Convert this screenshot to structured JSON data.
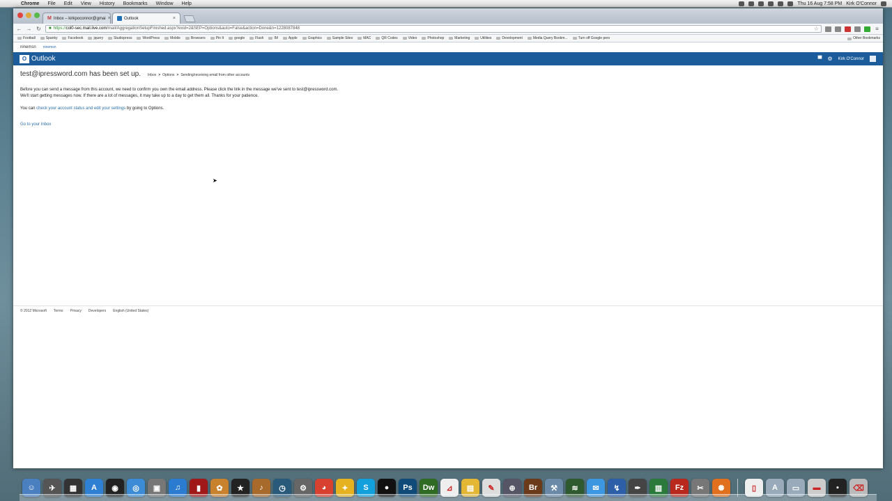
{
  "menubar": {
    "app": "Chrome",
    "items": [
      "File",
      "Edit",
      "View",
      "History",
      "Bookmarks",
      "Window",
      "Help"
    ],
    "clock": "Thu 16 Aug  7:58 PM",
    "user": "Kirk O'Connor"
  },
  "tabs": [
    {
      "title": "Inbox – kirkpoconnor@gmai",
      "favicon": "gmail-icon"
    },
    {
      "title": "Outlook",
      "favicon": "outlook-icon"
    }
  ],
  "address": {
    "proto": "https://",
    "host": "col0-sec.mail.live.com",
    "rest": "/mail/AggregationSetupFinished.aspx?exid=2&SEP=Options&auto=False&action=Done&n=1228087848"
  },
  "bookmarks": [
    "Football",
    "Spanky",
    "Facebook",
    "jquery",
    "Studiopress",
    "WordPress",
    "Mobile",
    "Browsers",
    "Pin It",
    "google",
    "Flash",
    "IM",
    "Apple",
    "Graphics",
    "Sample Sites",
    "MAC",
    "QR Codes",
    "Video",
    "Photoshop",
    "Marketing",
    "Utilities",
    "Development",
    "Media Query Bookm...",
    "Turn off Google pers"
  ],
  "bookmarks_other": "Other Bookmarks",
  "ninemsn": {
    "logo": "ninemsn",
    "link": "ninemsn"
  },
  "outlook": {
    "brand": "Outlook",
    "user": "Kirk O'Connor"
  },
  "page": {
    "title": "test@ipressword.com has been set up.",
    "breadcrumb": [
      "Inbox",
      "Options",
      "Sending/receiving email from other accounts"
    ],
    "line1": "Before you can send a message from this account, we need to confirm you own the email address. Please click the link in the message we've sent to test@ipressword.com.",
    "line2": "We'll start getting messages now. If there are a lot of messages, it may take up to a day to get them all. Thanks for your patience.",
    "you_can": "You can",
    "settings_link": "check your account status and edit your settings",
    "by_options": "by going to Options.",
    "inbox_link": "Go to your Inbox"
  },
  "footer": {
    "copyright": "© 2012 Microsoft",
    "links": [
      "Terms",
      "Privacy",
      "Developers",
      "English (United States)"
    ]
  },
  "dock": [
    {
      "name": "finder",
      "color": "#4a7fc0",
      "glyph": "☺"
    },
    {
      "name": "launchpad",
      "color": "#555",
      "glyph": "✈"
    },
    {
      "name": "mission-control",
      "color": "#333",
      "glyph": "▦"
    },
    {
      "name": "app-store",
      "color": "#2f7fd3",
      "glyph": "A"
    },
    {
      "name": "dashboard",
      "color": "#222",
      "glyph": "◉"
    },
    {
      "name": "safari",
      "color": "#3b8bd6",
      "glyph": "◎"
    },
    {
      "name": "preview",
      "color": "#777",
      "glyph": "▣"
    },
    {
      "name": "itunes",
      "color": "#2b7bd0",
      "glyph": "♫"
    },
    {
      "name": "photo-booth",
      "color": "#a01818",
      "glyph": "▮"
    },
    {
      "name": "iphoto",
      "color": "#c8822e",
      "glyph": "✿"
    },
    {
      "name": "imovie",
      "color": "#222",
      "glyph": "★"
    },
    {
      "name": "garageband",
      "color": "#a86a2a",
      "glyph": "♪"
    },
    {
      "name": "time-machine",
      "color": "#2a5a7a",
      "glyph": "◷"
    },
    {
      "name": "system-preferences",
      "color": "#666",
      "glyph": "⚙"
    },
    {
      "name": "chrome",
      "color": "#d8402f",
      "glyph": "◕"
    },
    {
      "name": "twitter",
      "color": "#e6b21f",
      "glyph": "✦"
    },
    {
      "name": "skype",
      "color": "#11a0dc",
      "glyph": "S"
    },
    {
      "name": "dvd-player",
      "color": "#111",
      "glyph": "●"
    },
    {
      "name": "photoshop",
      "color": "#0f4a78",
      "glyph": "Ps"
    },
    {
      "name": "dreamweaver",
      "color": "#2f6b22",
      "glyph": "Dw"
    },
    {
      "name": "acrobat",
      "color": "#eeeeee",
      "glyph": "⊿"
    },
    {
      "name": "stickies",
      "color": "#e3b634",
      "glyph": "▤"
    },
    {
      "name": "textedit",
      "color": "#ddd",
      "glyph": "✎"
    },
    {
      "name": "network-utility",
      "color": "#556",
      "glyph": "⊕"
    },
    {
      "name": "bridge",
      "color": "#6b3a1a",
      "glyph": "Br"
    },
    {
      "name": "xcode",
      "color": "#6a8aa8",
      "glyph": "⚒"
    },
    {
      "name": "activity-monitor",
      "color": "#2f5a2f",
      "glyph": "≋"
    },
    {
      "name": "messages",
      "color": "#3c97e0",
      "glyph": "✉"
    },
    {
      "name": "dropzone",
      "color": "#2c5fa8",
      "glyph": "↯"
    },
    {
      "name": "pen-tool",
      "color": "#444",
      "glyph": "✒"
    },
    {
      "name": "numbers",
      "color": "#2b7a3b",
      "glyph": "▥"
    },
    {
      "name": "filezilla",
      "color": "#b8281d",
      "glyph": "Fz"
    },
    {
      "name": "cleaner",
      "color": "#777",
      "glyph": "✂"
    },
    {
      "name": "firefox",
      "color": "#e0701d",
      "glyph": "✺"
    }
  ],
  "dock_right": [
    {
      "name": "document",
      "color": "#eee",
      "glyph": "▯"
    },
    {
      "name": "applications-stack",
      "color": "#9ab",
      "glyph": "A"
    },
    {
      "name": "documents-stack",
      "color": "#9ab",
      "glyph": "▭"
    },
    {
      "name": "downloads-stack",
      "color": "#ccc",
      "glyph": "▬"
    },
    {
      "name": "screen-stack",
      "color": "#222",
      "glyph": "▪"
    },
    {
      "name": "trash",
      "color": "#bbb",
      "glyph": "⌫"
    }
  ]
}
